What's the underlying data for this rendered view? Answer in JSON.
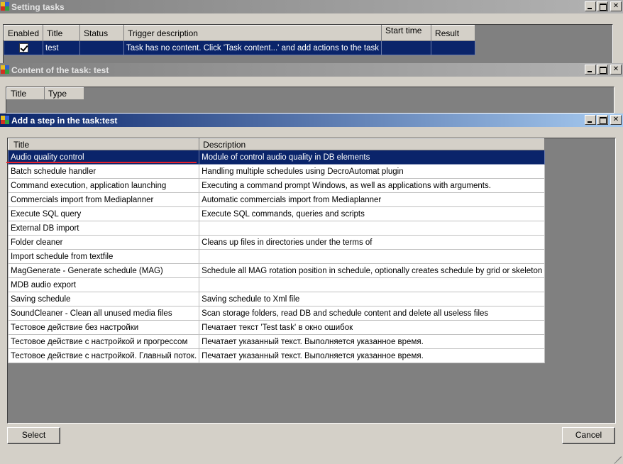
{
  "setting_tasks": {
    "title": "Setting tasks",
    "columns": [
      "Enabled",
      "Title",
      "Status",
      "Trigger description",
      "Start time",
      "Result"
    ],
    "rows": [
      {
        "enabled": true,
        "title": "test",
        "status": "",
        "trigger": "Task has no content. Click 'Task content...' and add actions to the task",
        "start_time": "",
        "result": ""
      }
    ]
  },
  "task_content": {
    "title": "Content of the task: test",
    "columns": [
      "Title",
      "Type"
    ]
  },
  "add_step": {
    "title": "Add a step in the task:test",
    "columns": [
      "Title",
      "Description"
    ],
    "rows": [
      {
        "title": "Audio quality control",
        "description": "Module of control audio quality in DB elements"
      },
      {
        "title": "Batch schedule handler",
        "description": "Handling multiple schedules using DecroAutomat plugin"
      },
      {
        "title": "Command execution, application launching",
        "description": "Executing a command prompt Windows, as well as applications with arguments."
      },
      {
        "title": "Commercials import from Mediaplanner",
        "description": "Automatic commercials import from Mediaplanner"
      },
      {
        "title": "Execute SQL query",
        "description": "Execute SQL commands, queries and scripts"
      },
      {
        "title": "External DB import",
        "description": ""
      },
      {
        "title": "Folder cleaner",
        "description": "Cleans up files in directories under the terms of"
      },
      {
        "title": "Import schedule from textfile",
        "description": ""
      },
      {
        "title": "MagGenerate - Generate schedule (MAG)",
        "description": "Schedule all MAG rotation position in schedule, optionally creates schedule by grid or skeleton"
      },
      {
        "title": "MDB audio export",
        "description": ""
      },
      {
        "title": "Saving schedule",
        "description": "Saving schedule to Xml file"
      },
      {
        "title": "SoundCleaner - Clean all unused media files",
        "description": "Scan storage folders, read DB and schedule content and delete all useless files"
      },
      {
        "title": "Тестовое действие без настройки",
        "description": "Печатает текст 'Test task' в окно ошибок"
      },
      {
        "title": "Тестовое действие с настройкой и прогрессом",
        "description": "Печатает указанный текст. Выполняется указанное время."
      },
      {
        "title": "Тестовое действие с настройкой. Главный поток.",
        "description": "Печатает указанный текст. Выполняется указанное время."
      }
    ],
    "selected_index": 0,
    "select_label": "Select",
    "cancel_label": "Cancel"
  },
  "colors": {
    "selection": "#0a246a",
    "active_title_start": "#0a246a",
    "active_title_end": "#a6caf0",
    "inactive_title": "#808080",
    "highlight_underline": "#e8202a",
    "workspace": "#808080"
  }
}
